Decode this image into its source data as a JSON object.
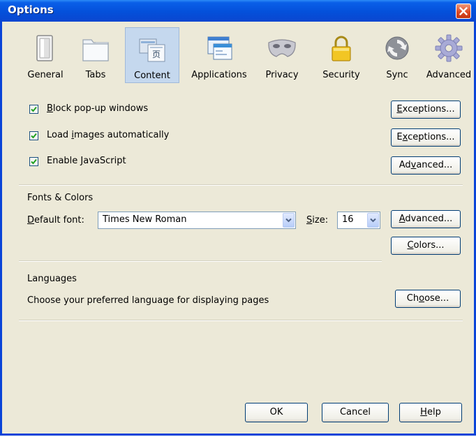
{
  "window": {
    "title": "Options"
  },
  "tabs": [
    {
      "id": "general",
      "label": "General",
      "icon": "switch-icon"
    },
    {
      "id": "tabs",
      "label": "Tabs",
      "icon": "folder-tabs-icon"
    },
    {
      "id": "content",
      "label": "Content",
      "icon": "document-content-icon",
      "selected": true
    },
    {
      "id": "applications",
      "label": "Applications",
      "icon": "applications-window-icon"
    },
    {
      "id": "privacy",
      "label": "Privacy",
      "icon": "mask-icon"
    },
    {
      "id": "security",
      "label": "Security",
      "icon": "padlock-icon"
    },
    {
      "id": "sync",
      "label": "Sync",
      "icon": "sync-icon"
    },
    {
      "id": "advanced",
      "label": "Advanced",
      "icon": "gear-icon"
    }
  ],
  "content": {
    "block_popups": {
      "label_pre": "",
      "label_key": "B",
      "label_post": "lock pop-up windows",
      "checked": true
    },
    "load_images": {
      "label_pre": "Load ",
      "label_key": "i",
      "label_post": "mages automatically",
      "checked": true
    },
    "enable_js": {
      "label_pre": "Enable ",
      "label_key": "J",
      "label_post": "avaScript",
      "checked": true
    },
    "exceptions1": {
      "pre": "",
      "key": "E",
      "post": "xceptions..."
    },
    "exceptions2": {
      "pre": "E",
      "key": "x",
      "post": "ceptions..."
    },
    "advanced_js": {
      "pre": "Ad",
      "key": "v",
      "post": "anced..."
    },
    "fonts": {
      "heading": "Fonts & Colors",
      "default_font_pre": "",
      "default_font_key": "D",
      "default_font_post": "efault font:",
      "default_font_value": "Times New Roman",
      "size_pre": "",
      "size_key": "S",
      "size_post": "ize:",
      "size_value": "16",
      "advanced_pre": "",
      "advanced_key": "A",
      "advanced_post": "dvanced...",
      "colors_pre": "",
      "colors_key": "C",
      "colors_post": "olors..."
    },
    "languages": {
      "heading": "Languages",
      "description": "Choose your preferred language for displaying pages",
      "choose_pre": "Ch",
      "choose_key": "o",
      "choose_post": "ose..."
    }
  },
  "footer": {
    "ok": "OK",
    "cancel": "Cancel",
    "help_pre": "",
    "help_key": "H",
    "help_post": "elp"
  },
  "colors": {
    "titlebar": "#0450da",
    "dialog_bg": "#ece9d8",
    "selected_tab": "#c5d8ee",
    "close_button": "#dd4a25",
    "checkmark": "#21a121"
  }
}
